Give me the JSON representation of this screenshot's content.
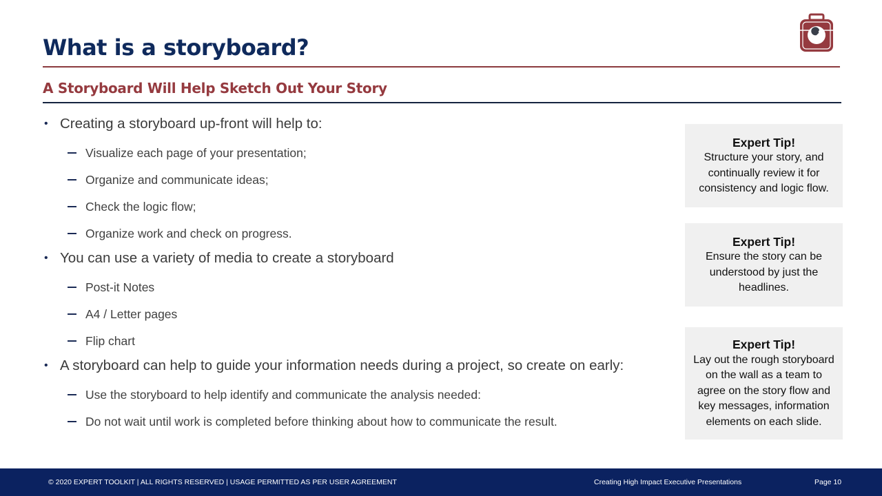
{
  "header": {
    "title": "What is a storyboard?",
    "subtitle": "A Storyboard Will Help Sketch Out Your Story",
    "logo_icon": "toolbox-wrench-icon"
  },
  "colors": {
    "title_navy": "#0f2a5c",
    "accent_red": "#953a3f",
    "footer_navy": "#0b2260",
    "tip_background": "#f0f0f0"
  },
  "content": {
    "bullets": [
      {
        "text": "Creating a storyboard up-front will help to:",
        "sub": [
          "Visualize each page of your presentation;",
          "Organize and communicate ideas;",
          "Check the logic flow;",
          "Organize work and check on progress."
        ]
      },
      {
        "text": "You can use a variety of media to create a storyboard",
        "sub": [
          "Post-it Notes",
          "A4 / Letter pages",
          "Flip chart"
        ]
      },
      {
        "text": "A storyboard can help to guide your information needs during a project, so create on early:",
        "sub": [
          "Use the storyboard to help identify and communicate the analysis needed:",
          "Do not wait until work is completed before thinking about how to communicate the result."
        ]
      }
    ]
  },
  "tips": [
    {
      "title": "Expert Tip!",
      "body": "Structure your story, and continually review it for consistency and logic flow."
    },
    {
      "title": "Expert Tip!",
      "body": "Ensure the story can be understood by just the headlines."
    },
    {
      "title": "Expert Tip!",
      "body": "Lay out the rough storyboard on the wall as a team to agree on the story flow and key messages, information elements on each slide."
    }
  ],
  "footer": {
    "copyright": "© 2020 EXPERT TOOLKIT | ALL RIGHTS RESERVED | USAGE PERMITTED AS PER USER AGREEMENT",
    "course": "Creating High Impact Executive Presentations",
    "page": "Page 10"
  }
}
